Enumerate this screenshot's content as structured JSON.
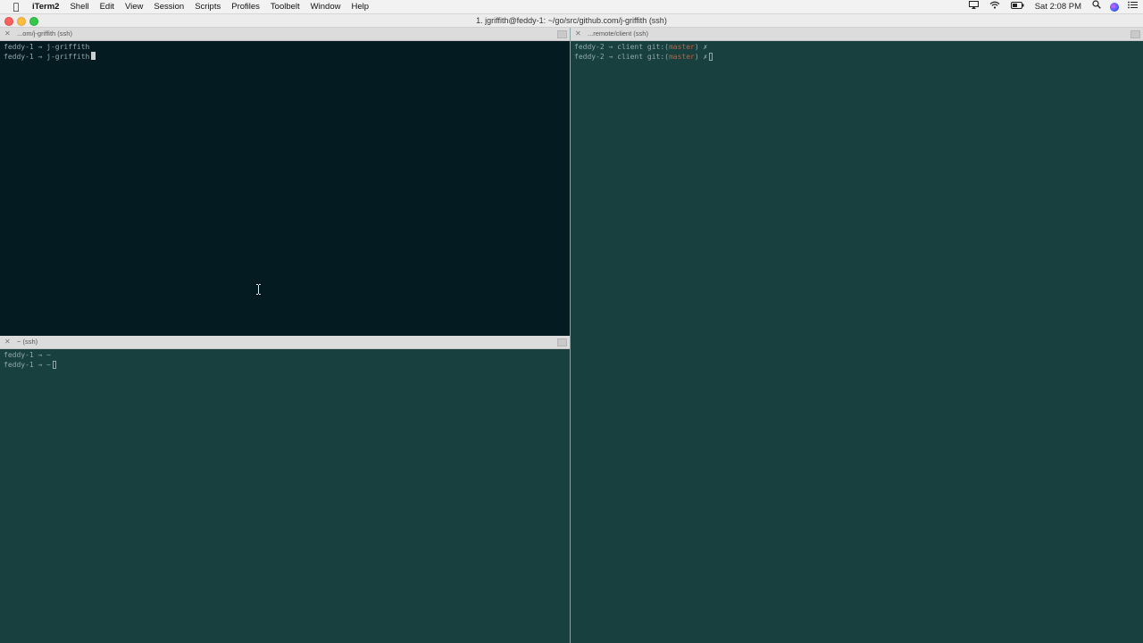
{
  "menubar": {
    "apple_icon": "apple-icon",
    "app_name": "iTerm2",
    "menus": [
      "Shell",
      "Edit",
      "View",
      "Session",
      "Scripts",
      "Profiles",
      "Toolbelt",
      "Window",
      "Help"
    ],
    "clock": "Sat 2:08 PM",
    "status_icons": [
      "airplay-icon",
      "wifi-icon",
      "battery-icon",
      "spotlight-search-icon",
      "siri-icon",
      "notification-center-icon"
    ]
  },
  "window": {
    "title": "1. jgriffith@feddy-1: ~/go/src/github.com/j-griffith (ssh)"
  },
  "panes": {
    "top_left": {
      "tab_label": "...om/j-griffith (ssh)",
      "lines": [
        "feddy-1 → j-griffith",
        "feddy-1 → j-griffith"
      ]
    },
    "bottom_left": {
      "tab_label": "~ (ssh)",
      "lines": [
        "feddy-1 → ~",
        "feddy-1 → ~"
      ]
    },
    "right": {
      "tab_label": "...remote/client (ssh)",
      "prompt_prefix": "feddy-2 → client git:(",
      "branch": "master",
      "prompt_suffix": ") ✗"
    }
  },
  "colors": {
    "active_pane_bg": "#051b22",
    "inactive_pane_bg": "#18403f",
    "prompt_text": "#93a8ad",
    "branch_text": "#c2613b"
  }
}
